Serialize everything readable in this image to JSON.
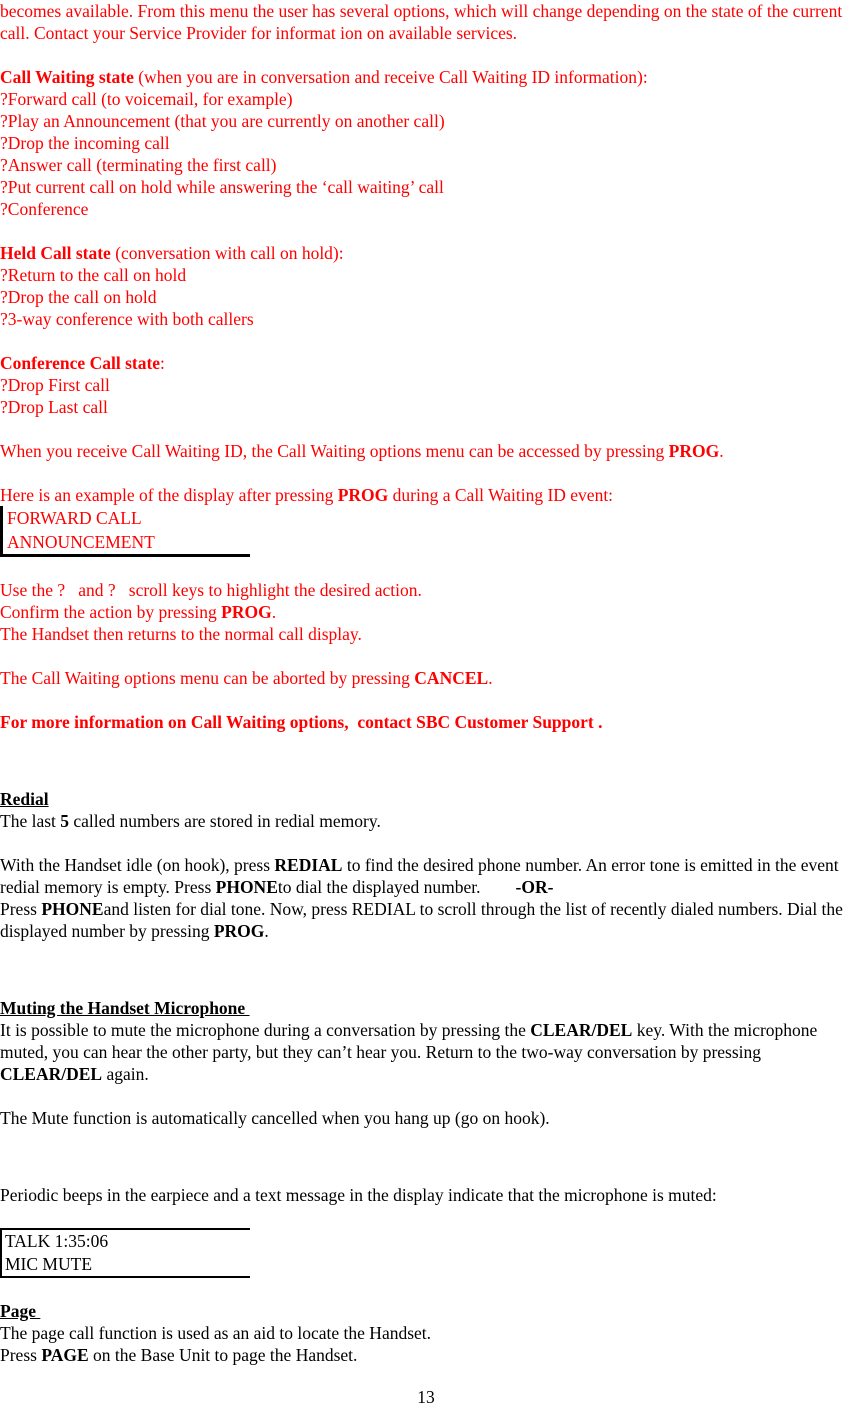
{
  "document": {
    "page_number": "13",
    "text_color_red": "#FF0000",
    "text_color_black": "#000000"
  },
  "intro": {
    "paragraph": "becomes available.  From this menu the user has several options, which will change depending on the state of the current call.  Contact your Service Provider for informat ion on available services."
  },
  "call_waiting_state": {
    "heading": "Call Waiting state",
    "heading_suffix": " (when you are in conversation and receive Call Waiting ID information):",
    "bullet_glyph": "?",
    "items": [
      "Forward call (to voicemail, for example)",
      "Play an Announcement (that you are currently on another call)",
      "Drop the incoming call",
      "Answer call (terminating the first call)",
      "Put current call on hold while answering the ‘call waiting’ call",
      "Conference"
    ]
  },
  "held_call_state": {
    "heading": "Held Call state",
    "heading_suffix": " (conversation with call on hold):",
    "bullet_glyph": "?",
    "items": [
      "Return to the call on hold",
      "Drop the call on hold",
      "3-way conference with both callers"
    ]
  },
  "conference_call_state": {
    "heading": "Conference Call state",
    "heading_suffix": ":",
    "bullet_glyph": "?",
    "items": [
      "Drop First call",
      "Drop Last call"
    ]
  },
  "prog_access": {
    "text_before": "When you receive Call Waiting ID, the Call Waiting options menu can be accessed by pressing ",
    "key": "PROG",
    "text_after": "."
  },
  "example_intro": {
    "text_before": "Here is an example of the display after pressing ",
    "key": "PROG",
    "text_after": " during a Call Waiting ID event:"
  },
  "lcd_forward_call": {
    "line1": "FORWARD CALL",
    "line2": "ANNOUNCEMENT"
  },
  "scroll_instructions": {
    "line1": "Use the ?   and ?   scroll keys to highlight the desired action.",
    "line2_before": "Confirm the action by pressing ",
    "line2_key": "PROG",
    "line2_after": ".",
    "line3": "The Handset then returns to the normal call display."
  },
  "abort_instruction": {
    "text_before": "The Call Waiting options menu can be aborted by pressing ",
    "key": "CANCEL",
    "text_after": "."
  },
  "more_info": {
    "text": "For more information on Call Waiting options,  contact SBC Customer Support ."
  },
  "redial": {
    "heading": "Redial",
    "line1_before": "The last ",
    "line1_bold": "5",
    "line1_after": " called numbers are stored in redial memory.",
    "body_seg1": "With the Handset idle (on hook), press ",
    "body_key1": "REDIAL",
    "body_seg2": " to find the desired phone number. An error tone is emitted in the event redial memory is empty. Press ",
    "body_key2": "PHONE",
    "body_seg3": "to dial the displayed number.        ",
    "body_key3": "-OR-",
    "body_seg4": "Press ",
    "body_key4": "PHONE",
    "body_seg5": "and listen for dial tone.  Now, press REDIAL to scroll through the list of recently dialed numbers.  Dial the displayed number by pressing ",
    "body_key5": "PROG",
    "body_seg6": "."
  },
  "muting": {
    "heading": "Muting the Handset Microphone ",
    "body_seg1": "It is possible to mute the microphone during a conversation by pressing the ",
    "body_key1": "CLEAR/DEL",
    "body_seg2": " key.  With the microphone muted, you can hear the other party, but they can’t hear you.  Return to the two-way conversation by pressing ",
    "body_key2": "CLEAR/DEL",
    "body_seg3": " again.",
    "mute_cancel": "The Mute function is automatically cancelled when you hang up (go on hook).",
    "beeps": "Periodic beeps in the earpiece and a text message in the display indicate that the microphone is muted:"
  },
  "lcd_mic_mute": {
    "line1": "TALK 1:35:06",
    "line2": "MIC MUTE"
  },
  "page_section": {
    "heading": "Page ",
    "line1": "The page call function is used as an aid to locate the Handset.",
    "line2_before": "Press ",
    "line2_key": "PAGE",
    "line2_after": " on the Base Unit to page the Handset."
  }
}
